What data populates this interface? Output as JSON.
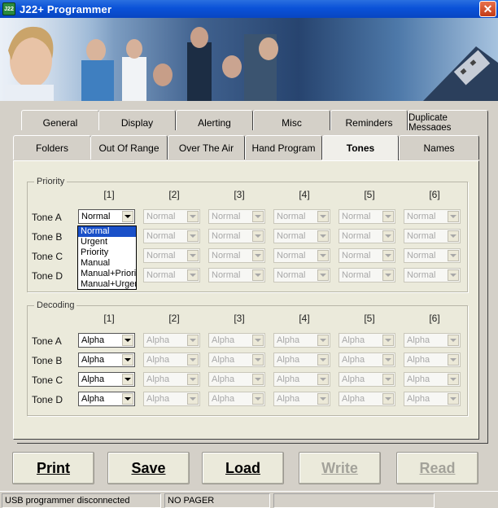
{
  "window": {
    "title": "J22+ Programmer",
    "close_symbol": "✕"
  },
  "tabs_row1": [
    "General",
    "Display",
    "Alerting",
    "Misc",
    "Reminders",
    "Duplicate Messages"
  ],
  "tabs_row2": [
    "Folders",
    "Out Of Range",
    "Over The Air",
    "Hand Program",
    "Tones",
    "Names"
  ],
  "active_tab": "Tones",
  "columns": [
    "[1]",
    "[2]",
    "[3]",
    "[4]",
    "[5]",
    "[6]"
  ],
  "rows": [
    "Tone A",
    "Tone B",
    "Tone C",
    "Tone D"
  ],
  "priority": {
    "legend": "Priority",
    "value": "Normal",
    "dropdown_options": [
      "Normal",
      "Urgent",
      "Priority",
      "Manual",
      "Manual+Priority",
      "Manual+Urgent"
    ],
    "dropdown_selected": "Normal"
  },
  "decoding": {
    "legend": "Decoding",
    "value": "Alpha"
  },
  "buttons": {
    "print": "Print",
    "save": "Save",
    "load": "Load",
    "write": "Write",
    "read": "Read"
  },
  "status": {
    "connection": "USB programmer disconnected",
    "pager": "NO PAGER",
    "extra": ""
  }
}
